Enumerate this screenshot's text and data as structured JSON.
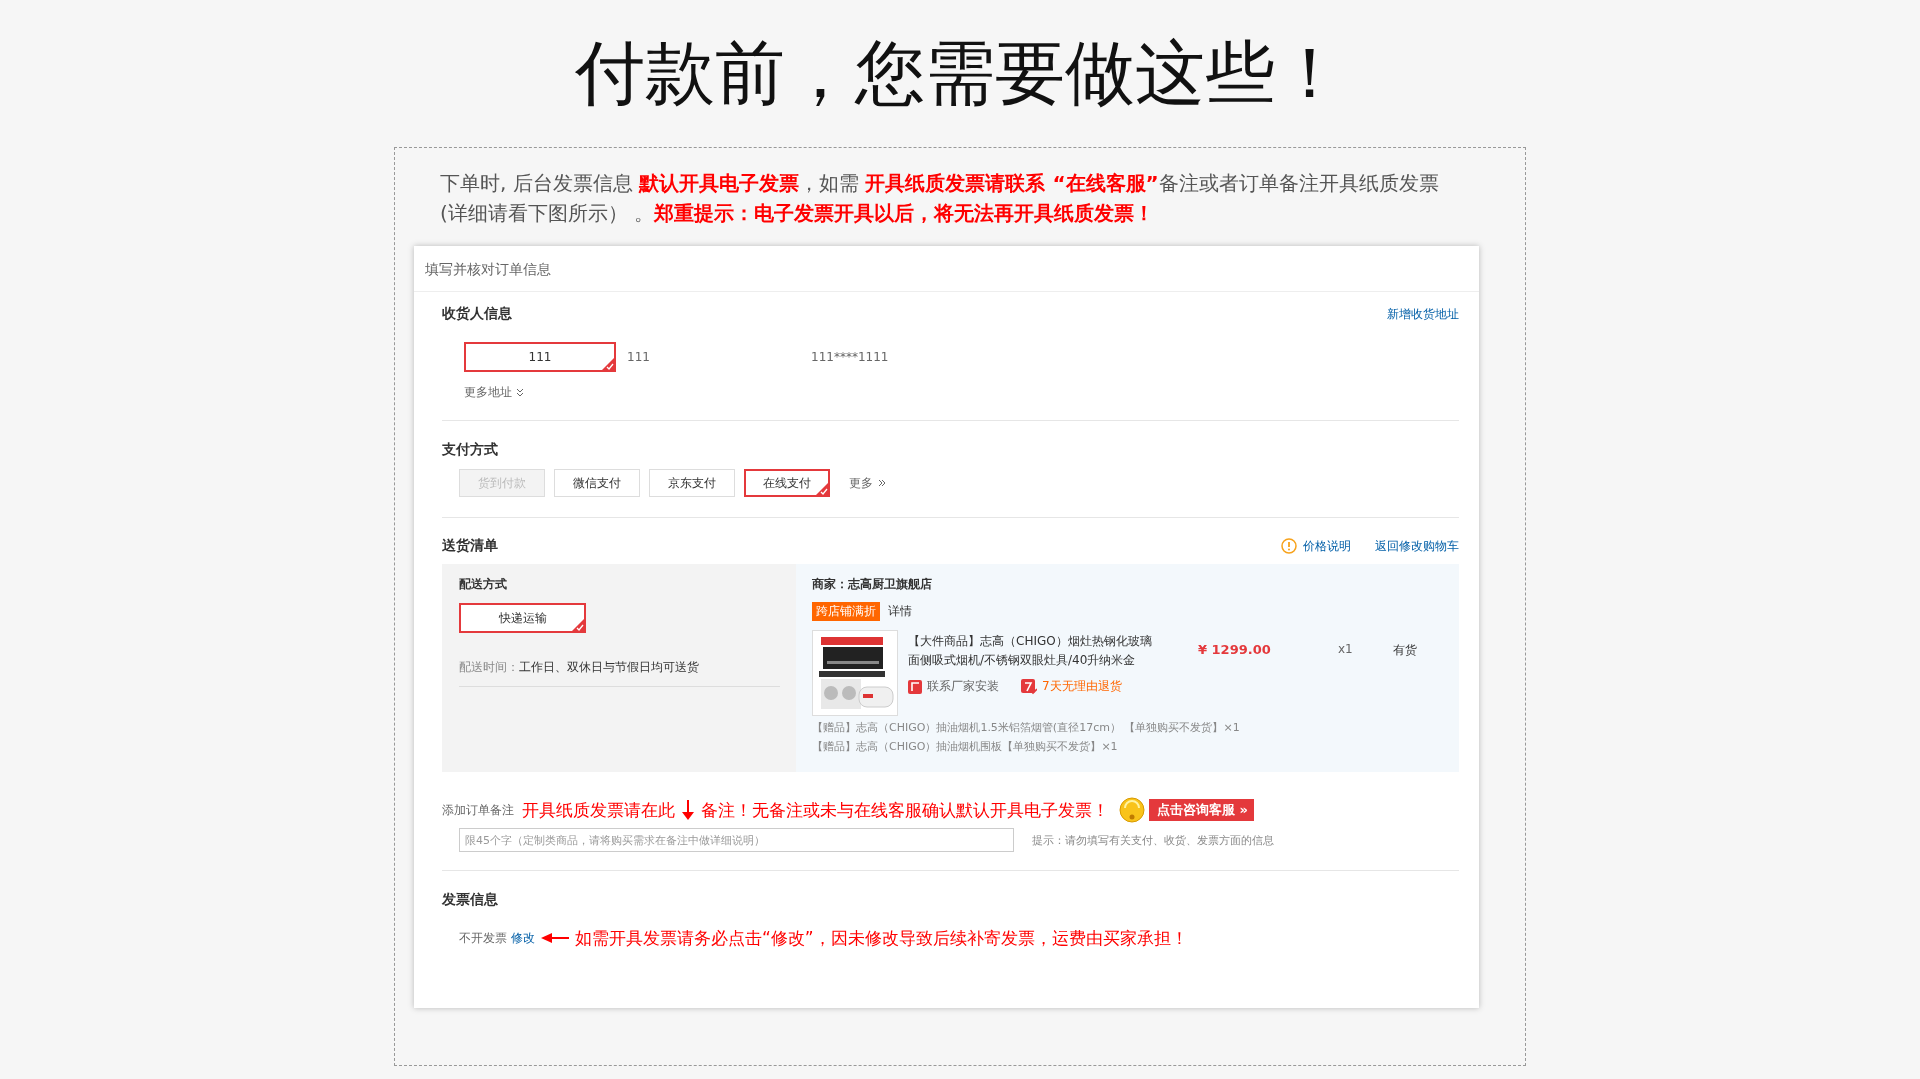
{
  "title": "付款前，您需要做这些！",
  "intro": "下单时, 后台发票信息 **默认开具电子发票**，如需 **开具纸质发票请联系 “在线客服”**备注或者订单备注开具纸质发票(详细请看下图所示） 。**郑重提示：电子发票开具以后，将无法再开具纸质发票！**",
  "order": {
    "heading": "填写并核对订单信息",
    "recipient": {
      "title": "收货人信息",
      "add_link": "新增收货地址",
      "more": "更多地址",
      "addresses": [
        {
          "name": "111",
          "recipient": "111",
          "phone": "111****1111",
          "selected": true
        }
      ]
    },
    "payment": {
      "title": "支付方式",
      "more": "更多",
      "options": [
        {
          "label": "货到付款",
          "selected": false,
          "disabled": true
        },
        {
          "label": "微信支付",
          "selected": false,
          "disabled": false
        },
        {
          "label": "京东支付",
          "selected": false,
          "disabled": false
        },
        {
          "label": "在线支付",
          "selected": true,
          "disabled": false
        }
      ]
    },
    "delivery": {
      "title": "送货清单",
      "price_note": "价格说明",
      "back_link": "返回修改购物车",
      "shipping": {
        "title": "配送方式",
        "options": [
          {
            "label": "快递运输",
            "selected": true
          }
        ],
        "time_label": "配送时间：",
        "time": "工作日、双休日与节假日均可送货"
      },
      "shop": "商家：志高厨卫旗舰店",
      "promo_tag": "跨店铺满折",
      "promo_link": "详情",
      "product": {
        "name": "【大件商品】志高（CHIGO）烟灶热钢化玻璃面侧吸式烟机/不锈钢双眼灶具/40升纳米金",
        "price": "¥ 1299.00",
        "qty": "x1",
        "stock": "有货",
        "services": [
          {
            "kind": "install",
            "label": "联系厂家安装"
          },
          {
            "kind": "return",
            "label": "7天无理由退货"
          }
        ]
      },
      "gifts": [
        "【赠品】志高（CHIGO）抽油烟机1.5米铝箔烟管(直径17cm） 【单独购买不发货】×1",
        "【赠品】志高（CHIGO）抽油烟机围板【单独购买不发货】×1"
      ]
    },
    "remark": {
      "label": "添加订单备注",
      "annotation_before": "开具纸质发票请在此",
      "annotation_after": "备注！无备注或未与在线客服确认默认开具电子发票！",
      "consult_button": "点击咨询客服 »",
      "placeholder": "限45个字（定制类商品，请将购买需求在备注中做详细说明）",
      "hint": "提示：请勿填写有关支付、收货、发票方面的信息"
    },
    "invoice": {
      "title": "发票信息",
      "value": "不开发票",
      "edit_link": "修改",
      "annotation": "如需开具发票请务必点击“修改”，因未修改导致后续补寄发票，运费由买家承担！"
    }
  }
}
